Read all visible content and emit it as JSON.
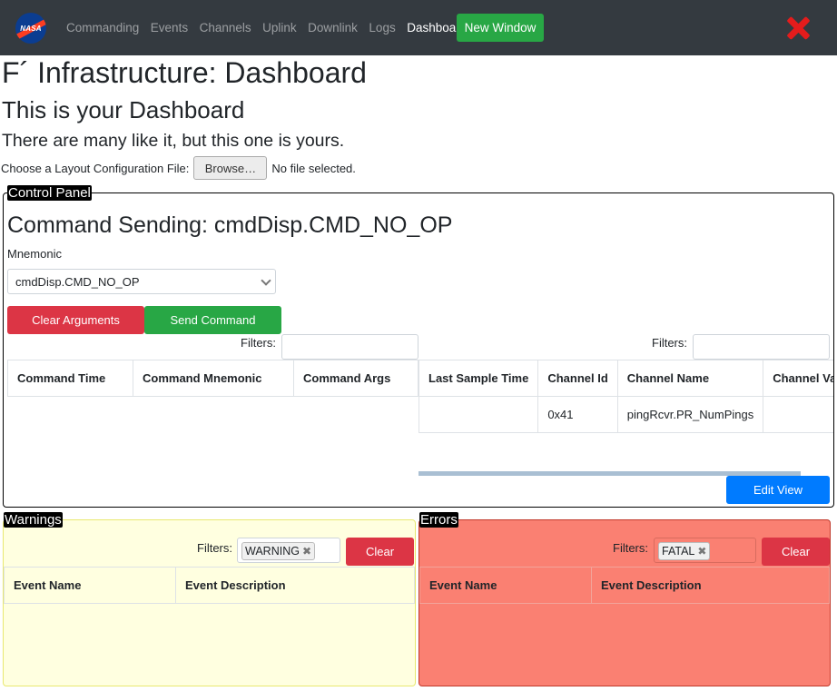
{
  "nav": {
    "logo_text": "NASA",
    "links": [
      "Commanding",
      "Events",
      "Channels",
      "Uplink",
      "Downlink",
      "Logs",
      "Dashboard"
    ],
    "active": "Dashboard",
    "new_window": "New Window"
  },
  "page": {
    "title": "F´ Infrastructure: Dashboard",
    "subtitle": "This is your Dashboard",
    "tagline": "There are many like it, but this one is yours.",
    "layout_label": "Choose a Layout Configuration File:",
    "browse": "Browse…",
    "no_file": "No file selected."
  },
  "control_panel": {
    "legend": "Control Panel",
    "cmd_title": "Command Sending: cmdDisp.CMD_NO_OP",
    "mnemonic_label": "Mnemonic",
    "mnemonic_value": "cmdDisp.CMD_NO_OP",
    "clear_args": "Clear Arguments",
    "send_command": "Send Command",
    "cmd_filters_label": "Filters:",
    "cmd_columns": [
      "Command Time",
      "Command Mnemonic",
      "Command Args"
    ],
    "chan_filters_label": "Filters:",
    "chan_columns": [
      "Last Sample Time",
      "Channel Id",
      "Channel Name",
      "Channel Val"
    ],
    "chan_rows": [
      {
        "time": "",
        "id": "0x41",
        "name": "pingRcvr.PR_NumPings",
        "value": ""
      }
    ],
    "edit_view": "Edit View"
  },
  "warnings": {
    "legend": "Warnings",
    "filters_label": "Filters:",
    "tag": "WARNING",
    "clear": "Clear",
    "columns": [
      "Event Name",
      "Event Description"
    ]
  },
  "errors": {
    "legend": "Errors",
    "filters_label": "Filters:",
    "tag": "FATAL",
    "clear": "Clear",
    "columns": [
      "Event Name",
      "Event Description"
    ]
  },
  "colors": {
    "navbar": "#343a40",
    "success": "#28a745",
    "danger": "#dc3545",
    "primary": "#007bff",
    "warning_bg": "#ffffe0",
    "error_bg": "#fa8072"
  }
}
